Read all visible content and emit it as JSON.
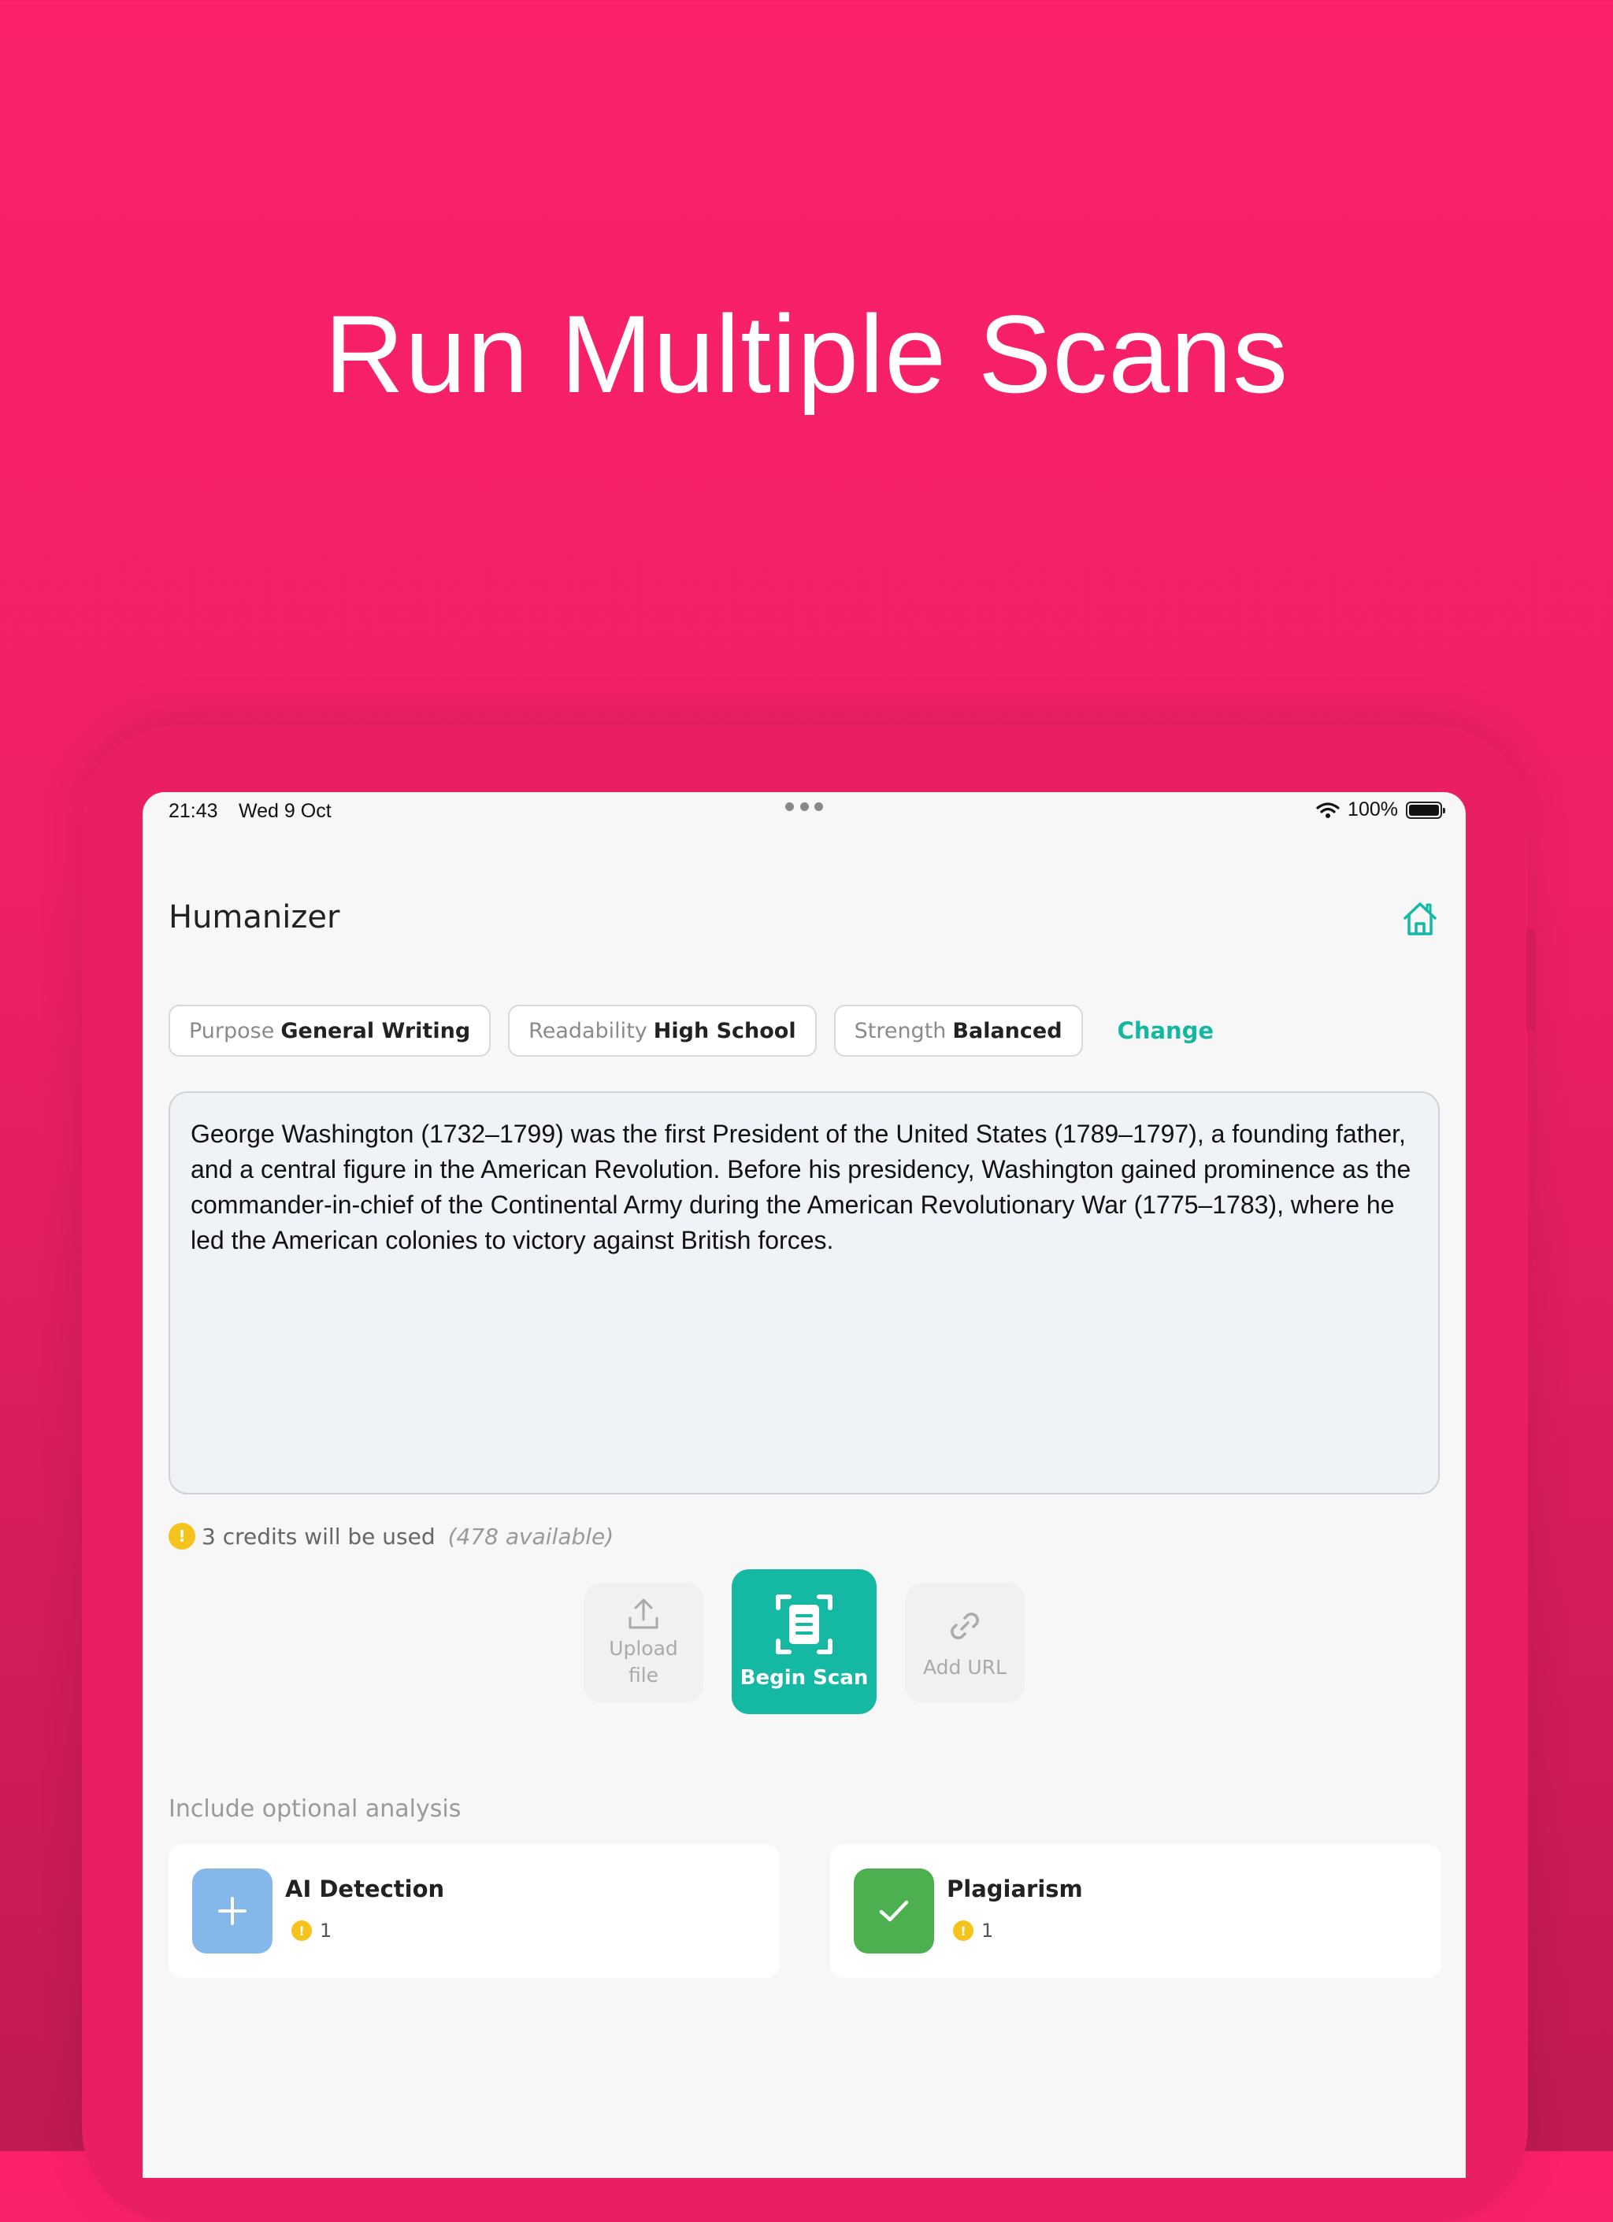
{
  "headline": "Run Multiple Scans",
  "status_bar": {
    "time": "21:43",
    "date": "Wed 9 Oct",
    "battery": "100%"
  },
  "header": {
    "title": "Humanizer",
    "home_icon": "home-icon"
  },
  "settings": {
    "purpose_label": "Purpose",
    "purpose_value": "General Writing",
    "readability_label": "Readability",
    "readability_value": "High School",
    "strength_label": "Strength",
    "strength_value": "Balanced",
    "change_label": "Change"
  },
  "editor": {
    "text": "George Washington (1732–1799) was the first President of the United States (1789–1797), a founding father, and a central figure in the American Revolution. Before his presidency, Washington gained prominence as the commander-in-chief of the Continental Army during the American Revolutionary War (1775–1783), where he led the American colonies to victory against British forces."
  },
  "credits": {
    "coin_glyph": "!",
    "used_text": "3 credits will be used",
    "available_text": "(478 available)"
  },
  "actions": {
    "upload_label": "Upload file",
    "scan_label": "Begin Scan",
    "url_label": "Add URL"
  },
  "optional": {
    "section_label": "Include optional analysis",
    "cards": [
      {
        "title": "AI Detection",
        "cost": "1",
        "state": "add"
      },
      {
        "title": "Plagiarism",
        "cost": "1",
        "state": "checked"
      }
    ]
  },
  "colors": {
    "background": "#fc2169",
    "accent": "#14b8a3",
    "coin": "#f4c31c",
    "ai_toggle": "#85b8ea",
    "plagiarism_toggle": "#4caf50"
  }
}
